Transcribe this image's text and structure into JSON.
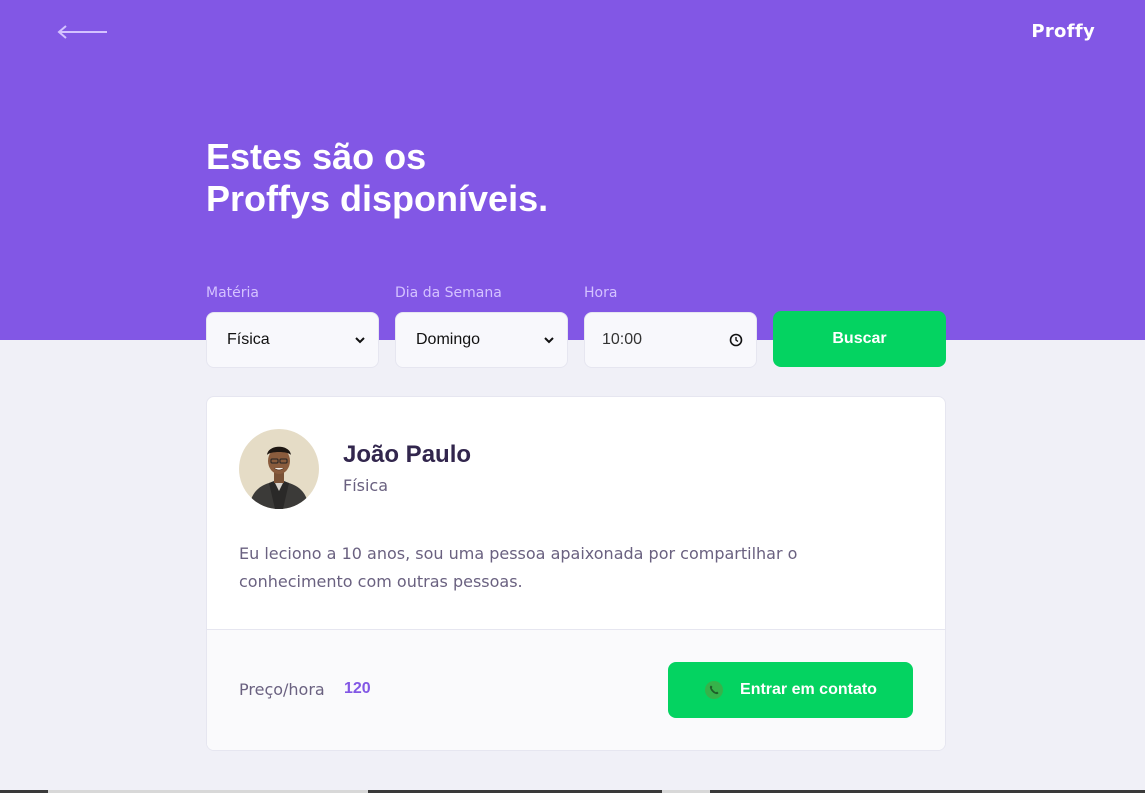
{
  "header": {
    "back_icon": "arrow-left-icon",
    "logo": "Proffy",
    "title_line1": "Estes são os",
    "title_line2": "Proffys disponíveis."
  },
  "filters": {
    "subject": {
      "label": "Matéria",
      "value": "Física"
    },
    "weekday": {
      "label": "Dia da Semana",
      "value": "Domingo"
    },
    "time": {
      "label": "Hora",
      "value": "10:00"
    },
    "search_button": "Buscar"
  },
  "teacher": {
    "name": "João Paulo",
    "subject": "Física",
    "bio": "Eu leciono a 10 anos, sou uma pessoa apaixonada por compartilhar o conhecimento com outras pessoas.",
    "price_label": "Preço/hora",
    "price_value": "120",
    "contact_button": "Entrar em contato",
    "contact_icon": "whatsapp-icon"
  },
  "colors": {
    "primary": "#8257E5",
    "secondary": "#04D361",
    "background": "#F0F0F7",
    "title_text": "#32264D",
    "body_text": "#6A6180"
  }
}
